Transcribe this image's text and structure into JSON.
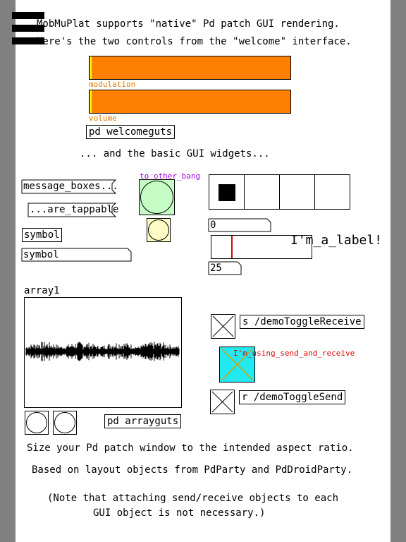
{
  "header": {
    "line1": "MobMuPlat supports \"native\" Pd patch GUI rendering.",
    "line2": "Here's the two controls from the \"welcome\" interface."
  },
  "sliders": [
    {
      "label": "modulation",
      "value_fraction": 0.0
    },
    {
      "label": "volume",
      "value_fraction": 0.0
    }
  ],
  "colors": {
    "slider_fill": "#ff8000",
    "slider_label": "#e07800",
    "bang_green": "#c4fcc4",
    "bang_yellow": "#fcfcc4",
    "bang_label": "#a000e0",
    "cyan_toggle": "#22e8f0",
    "red_label": "#e00000",
    "side_gray": "#808080"
  },
  "objects": {
    "welcomeguts": "pd welcomeguts",
    "arrayguts": "pd arrayguts",
    "demo_receive": "s /demoToggleReceive",
    "demo_send": "r /demoToggleSend"
  },
  "basic_gui_text": "... and the basic GUI widgets...",
  "messages": {
    "message_boxes": "message_boxes...",
    "are_tappable": "...are_tappable",
    "symbol_box": "symbol",
    "symbol_atom": "symbol"
  },
  "bang": {
    "label": "to_other_bang"
  },
  "radio": {
    "cells": 4,
    "selected_index": 0
  },
  "number_atoms": {
    "top": "0",
    "bottom": "25"
  },
  "hslider": {
    "value_fraction": 0.2
  },
  "big_label": "I'm_a_label!",
  "array": {
    "name": "array1"
  },
  "send_receive_label": "I'm_using_send_and_receive",
  "footer": {
    "line1": "Size your Pd patch window to the intended aspect ratio.",
    "line2": "Based on layout objects from PdParty and PdDroidParty.",
    "line3": "(Note that attaching send/receive objects to each",
    "line4": "GUI object is not necessary.)"
  },
  "icons": {
    "menu": "hamburger-menu-icon"
  }
}
